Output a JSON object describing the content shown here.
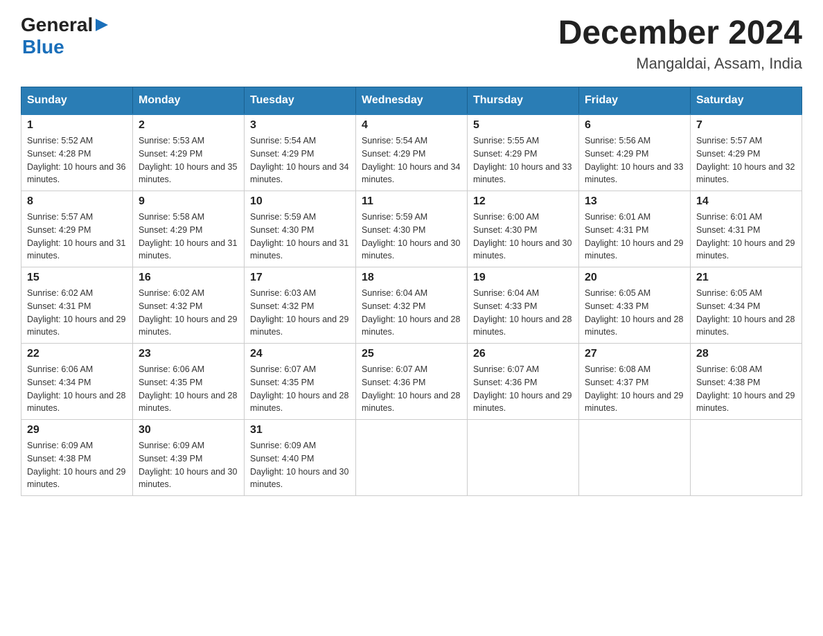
{
  "header": {
    "logo_general": "General",
    "logo_blue": "Blue",
    "month_title": "December 2024",
    "location": "Mangaldai, Assam, India"
  },
  "days_of_week": [
    "Sunday",
    "Monday",
    "Tuesday",
    "Wednesday",
    "Thursday",
    "Friday",
    "Saturday"
  ],
  "weeks": [
    [
      {
        "day": "1",
        "sunrise": "5:52 AM",
        "sunset": "4:28 PM",
        "daylight": "10 hours and 36 minutes."
      },
      {
        "day": "2",
        "sunrise": "5:53 AM",
        "sunset": "4:29 PM",
        "daylight": "10 hours and 35 minutes."
      },
      {
        "day": "3",
        "sunrise": "5:54 AM",
        "sunset": "4:29 PM",
        "daylight": "10 hours and 34 minutes."
      },
      {
        "day": "4",
        "sunrise": "5:54 AM",
        "sunset": "4:29 PM",
        "daylight": "10 hours and 34 minutes."
      },
      {
        "day": "5",
        "sunrise": "5:55 AM",
        "sunset": "4:29 PM",
        "daylight": "10 hours and 33 minutes."
      },
      {
        "day": "6",
        "sunrise": "5:56 AM",
        "sunset": "4:29 PM",
        "daylight": "10 hours and 33 minutes."
      },
      {
        "day": "7",
        "sunrise": "5:57 AM",
        "sunset": "4:29 PM",
        "daylight": "10 hours and 32 minutes."
      }
    ],
    [
      {
        "day": "8",
        "sunrise": "5:57 AM",
        "sunset": "4:29 PM",
        "daylight": "10 hours and 31 minutes."
      },
      {
        "day": "9",
        "sunrise": "5:58 AM",
        "sunset": "4:29 PM",
        "daylight": "10 hours and 31 minutes."
      },
      {
        "day": "10",
        "sunrise": "5:59 AM",
        "sunset": "4:30 PM",
        "daylight": "10 hours and 31 minutes."
      },
      {
        "day": "11",
        "sunrise": "5:59 AM",
        "sunset": "4:30 PM",
        "daylight": "10 hours and 30 minutes."
      },
      {
        "day": "12",
        "sunrise": "6:00 AM",
        "sunset": "4:30 PM",
        "daylight": "10 hours and 30 minutes."
      },
      {
        "day": "13",
        "sunrise": "6:01 AM",
        "sunset": "4:31 PM",
        "daylight": "10 hours and 29 minutes."
      },
      {
        "day": "14",
        "sunrise": "6:01 AM",
        "sunset": "4:31 PM",
        "daylight": "10 hours and 29 minutes."
      }
    ],
    [
      {
        "day": "15",
        "sunrise": "6:02 AM",
        "sunset": "4:31 PM",
        "daylight": "10 hours and 29 minutes."
      },
      {
        "day": "16",
        "sunrise": "6:02 AM",
        "sunset": "4:32 PM",
        "daylight": "10 hours and 29 minutes."
      },
      {
        "day": "17",
        "sunrise": "6:03 AM",
        "sunset": "4:32 PM",
        "daylight": "10 hours and 29 minutes."
      },
      {
        "day": "18",
        "sunrise": "6:04 AM",
        "sunset": "4:32 PM",
        "daylight": "10 hours and 28 minutes."
      },
      {
        "day": "19",
        "sunrise": "6:04 AM",
        "sunset": "4:33 PM",
        "daylight": "10 hours and 28 minutes."
      },
      {
        "day": "20",
        "sunrise": "6:05 AM",
        "sunset": "4:33 PM",
        "daylight": "10 hours and 28 minutes."
      },
      {
        "day": "21",
        "sunrise": "6:05 AM",
        "sunset": "4:34 PM",
        "daylight": "10 hours and 28 minutes."
      }
    ],
    [
      {
        "day": "22",
        "sunrise": "6:06 AM",
        "sunset": "4:34 PM",
        "daylight": "10 hours and 28 minutes."
      },
      {
        "day": "23",
        "sunrise": "6:06 AM",
        "sunset": "4:35 PM",
        "daylight": "10 hours and 28 minutes."
      },
      {
        "day": "24",
        "sunrise": "6:07 AM",
        "sunset": "4:35 PM",
        "daylight": "10 hours and 28 minutes."
      },
      {
        "day": "25",
        "sunrise": "6:07 AM",
        "sunset": "4:36 PM",
        "daylight": "10 hours and 28 minutes."
      },
      {
        "day": "26",
        "sunrise": "6:07 AM",
        "sunset": "4:36 PM",
        "daylight": "10 hours and 29 minutes."
      },
      {
        "day": "27",
        "sunrise": "6:08 AM",
        "sunset": "4:37 PM",
        "daylight": "10 hours and 29 minutes."
      },
      {
        "day": "28",
        "sunrise": "6:08 AM",
        "sunset": "4:38 PM",
        "daylight": "10 hours and 29 minutes."
      }
    ],
    [
      {
        "day": "29",
        "sunrise": "6:09 AM",
        "sunset": "4:38 PM",
        "daylight": "10 hours and 29 minutes."
      },
      {
        "day": "30",
        "sunrise": "6:09 AM",
        "sunset": "4:39 PM",
        "daylight": "10 hours and 30 minutes."
      },
      {
        "day": "31",
        "sunrise": "6:09 AM",
        "sunset": "4:40 PM",
        "daylight": "10 hours and 30 minutes."
      },
      null,
      null,
      null,
      null
    ]
  ]
}
